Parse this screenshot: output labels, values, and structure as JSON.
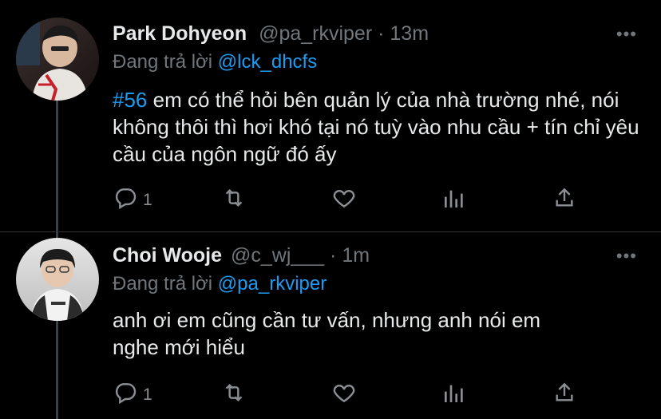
{
  "tweets": [
    {
      "name": "Park Dohyeon",
      "handle": "@pa_rkviper",
      "dot": "·",
      "time": "13m",
      "reply_prefix": "Đang trả lời",
      "reply_to": "@lck_dhcfs",
      "hashtag": "#56",
      "text": " em có thể hỏi bên quản lý của nhà trường nhé, nói không thôi thì hơi khó tại nó tuỳ vào nhu cầu + tín chỉ yêu cầu của ngôn ngữ đó ấy",
      "reply_count": "1",
      "more": "•••",
      "icons": [
        "reply-icon",
        "retweet-icon",
        "like-icon",
        "analytics-icon",
        "share-icon"
      ]
    },
    {
      "name": "Choi Wooje",
      "handle": "@c_wj___",
      "dot": "·",
      "time": "1m",
      "reply_prefix": "Đang trả lời",
      "reply_to": "@pa_rkviper",
      "text": "anh ơi em cũng cần tư vấn, nhưng anh nói em nghe mới hiểu",
      "reply_count": "1",
      "more": "•••",
      "icons": [
        "reply-icon",
        "retweet-icon",
        "like-icon",
        "analytics-icon",
        "share-icon"
      ]
    }
  ],
  "colors": {
    "background": "#000000",
    "accent": "#1d9bf0",
    "muted": "#71767b",
    "text": "#e7e9ea"
  }
}
